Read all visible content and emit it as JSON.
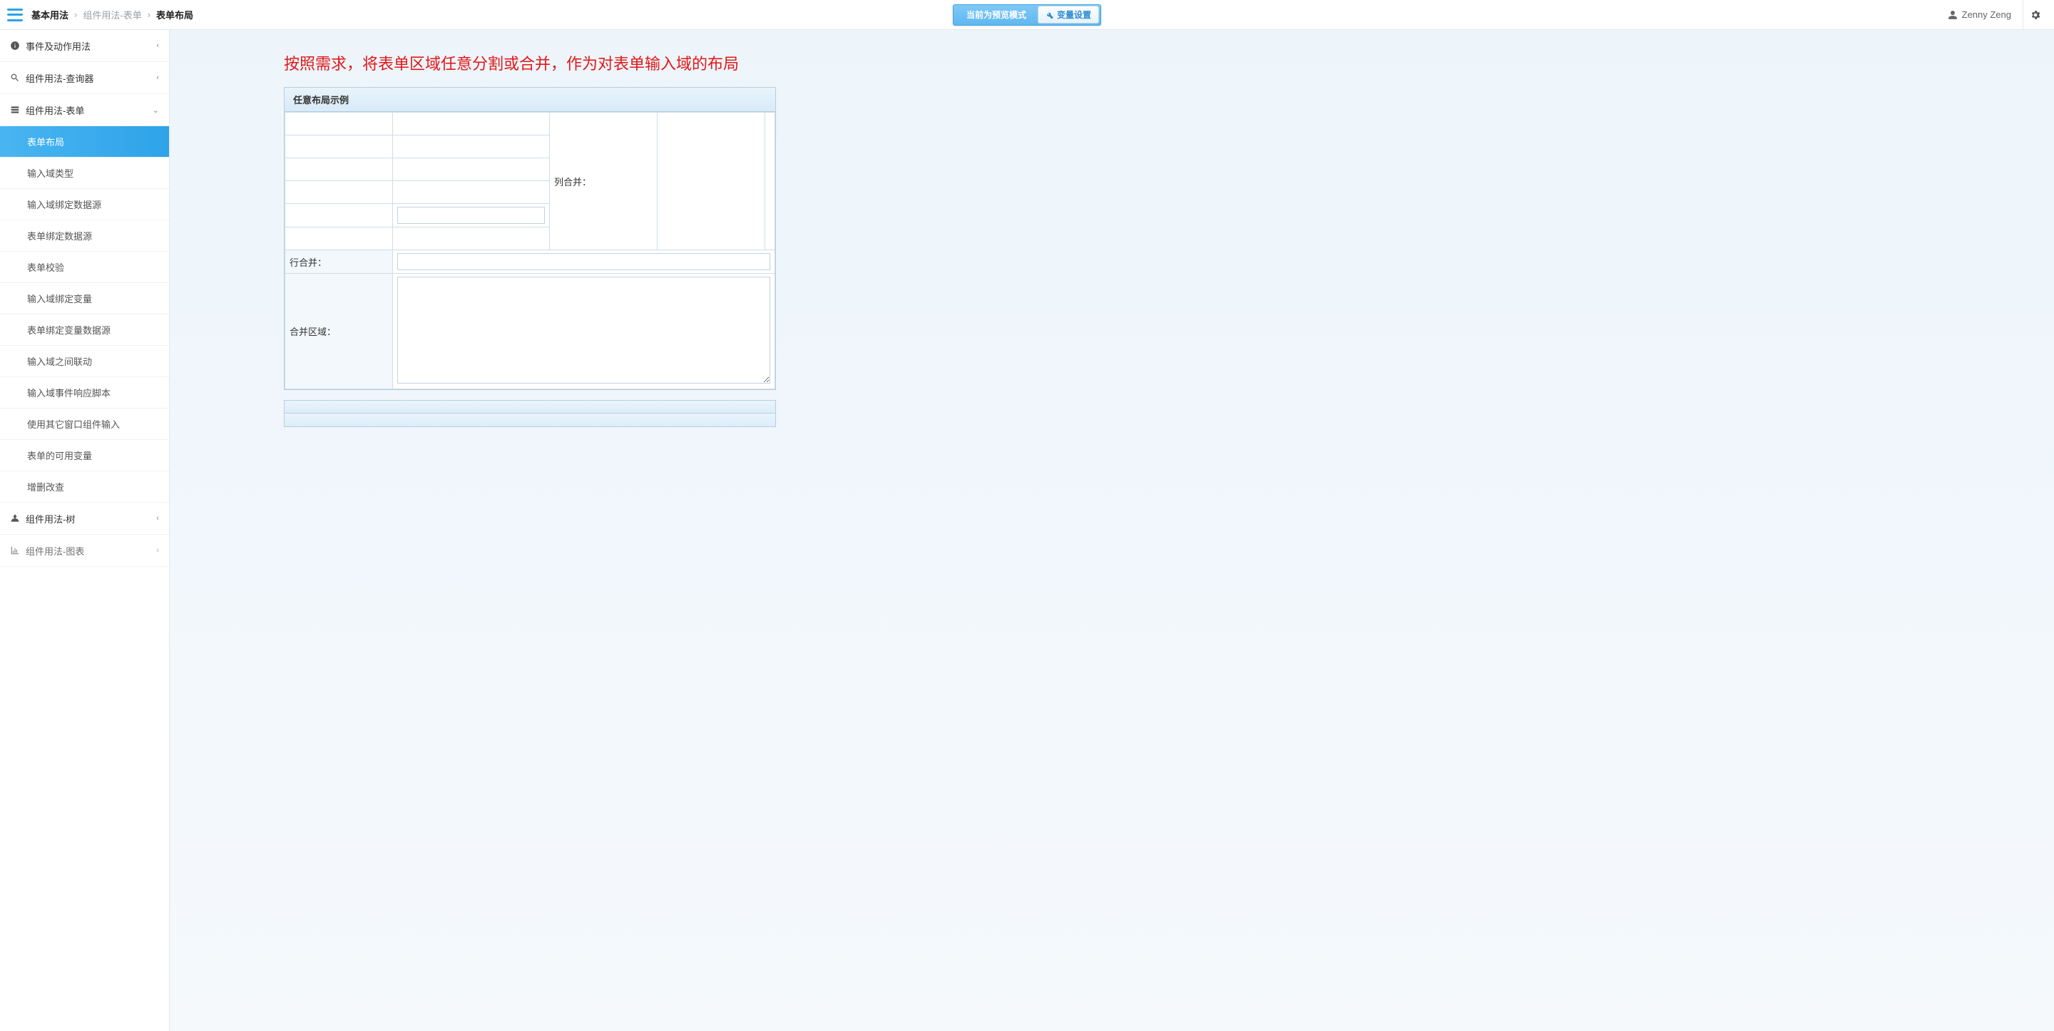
{
  "breadcrumb": {
    "root": "基本用法",
    "mid": "组件用法-表单",
    "current": "表单布局"
  },
  "topbar": {
    "preview_mode": "当前为预览模式",
    "var_settings": "变量设置"
  },
  "user": {
    "name": "Zenny Zeng"
  },
  "sidebar": {
    "groups": [
      {
        "label": "事件及动作用法",
        "icon": "info"
      },
      {
        "label": "组件用法-查询器",
        "icon": "search"
      },
      {
        "label": "组件用法-表单",
        "icon": "form",
        "expanded": true
      },
      {
        "label": "组件用法-树",
        "icon": "tree"
      },
      {
        "label": "组件用法-图表",
        "icon": "chart"
      }
    ],
    "form_items": [
      "表单布局",
      "输入域类型",
      "输入域绑定数据源",
      "表单绑定数据源",
      "表单校验",
      "输入域绑定变量",
      "表单绑定变量数据源",
      "输入域之间联动",
      "输入域事件响应脚本",
      "使用其它窗口组件输入",
      "表单的可用变量",
      "增删改查"
    ]
  },
  "content": {
    "title": "按照需求，将表单区域任意分割或合并，作为对表单输入域的布局",
    "panel_title": "任意布局示例",
    "col_merge_label": "列合并：",
    "row_merge_label": "行合并：",
    "merge_area_label": "合并区域："
  }
}
